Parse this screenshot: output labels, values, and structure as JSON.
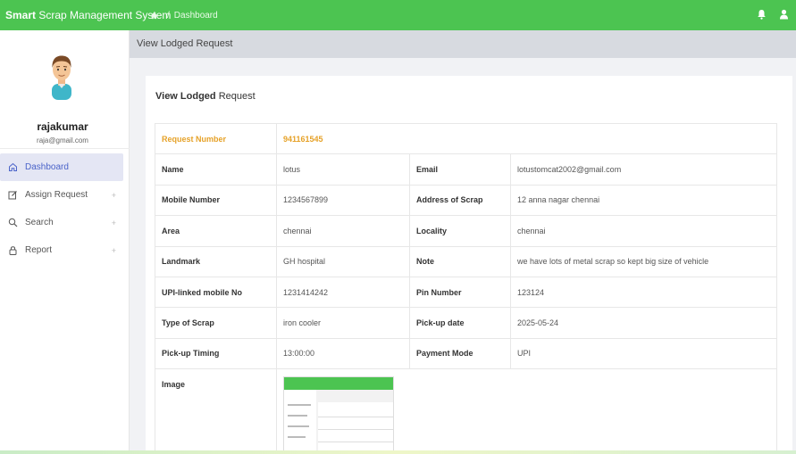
{
  "topbar": {
    "brand_bold": "Smart",
    "brand_rest": " Scrap Management System",
    "breadcrumb_sep": "/",
    "breadcrumb": "Dashboard"
  },
  "user": {
    "name": "rajakumar",
    "email": "raja@gmail.com"
  },
  "sidebar": {
    "items": [
      {
        "label": "Dashboard",
        "icon": "home-icon",
        "active": true
      },
      {
        "label": "Assign Request",
        "icon": "edit-icon",
        "plus": "+"
      },
      {
        "label": "Search",
        "icon": "search-icon",
        "plus": "+"
      },
      {
        "label": "Report",
        "icon": "lock-icon",
        "plus": "+"
      }
    ]
  },
  "page": {
    "header": "View Lodged Request",
    "card_title_bold": "View Lodged",
    "card_title_rest": " Request"
  },
  "details": {
    "request_number_label": "Request Number",
    "request_number": "941161545",
    "rows": [
      {
        "l1": "Name",
        "v1": "lotus",
        "l2": "Email",
        "v2": "lotustomcat2002@gmail.com"
      },
      {
        "l1": "Mobile Number",
        "v1": "1234567899",
        "l2": "Address of Scrap",
        "v2": "12 anna nagar chennai"
      },
      {
        "l1": "Area",
        "v1": "chennai",
        "l2": "Locality",
        "v2": "chennai"
      },
      {
        "l1": "Landmark",
        "v1": "GH hospital",
        "l2": "Note",
        "v2": "we have lots of metal scrap so kept big size of vehicle"
      },
      {
        "l1": "UPI-linked mobile No",
        "v1": "1231414242",
        "l2": "Pin Number",
        "v2": "123124"
      },
      {
        "l1": "Type of Scrap",
        "v1": "iron cooler",
        "l2": "Pick-up date",
        "v2": "2025-05-24"
      },
      {
        "l1": "Pick-up Timing",
        "v1": "13:00:00",
        "l2": "Payment Mode",
        "v2": "UPI"
      }
    ],
    "image_label": "Image"
  },
  "colors": {
    "topbar": "#4cc451",
    "accent": "#e6a229",
    "active_nav": "#4a63c9"
  }
}
